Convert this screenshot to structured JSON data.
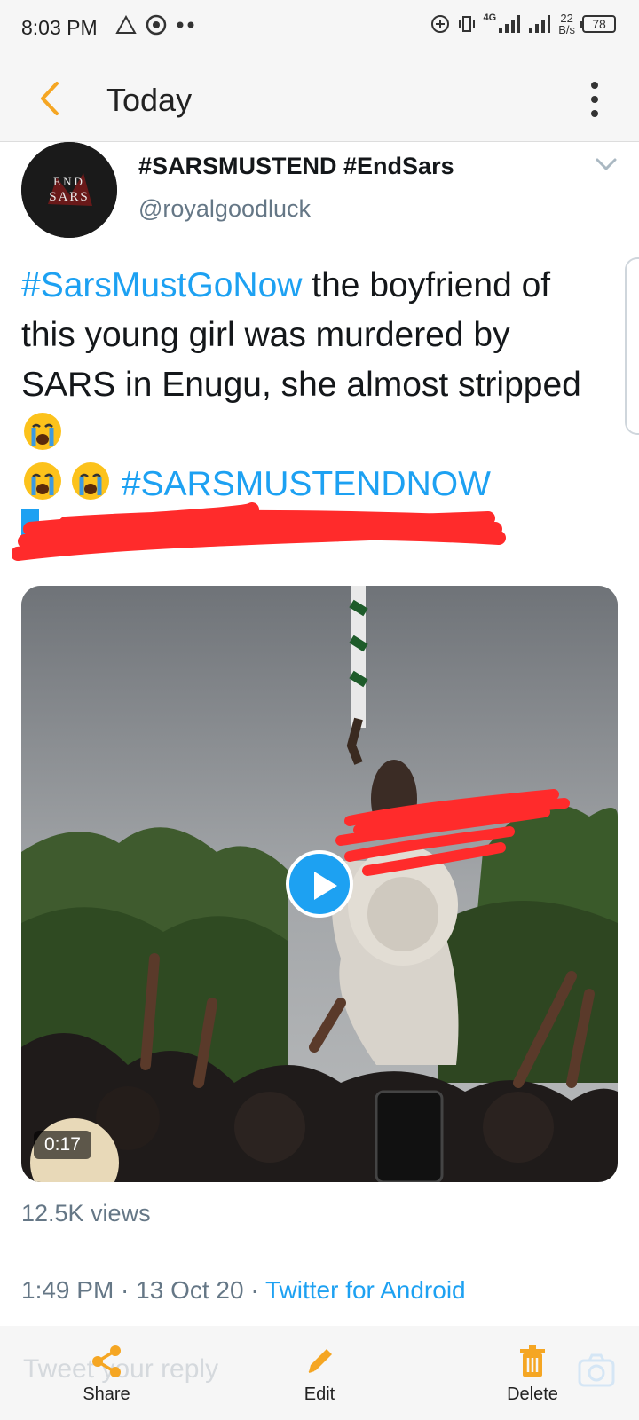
{
  "status_bar": {
    "time": "8:03 PM",
    "network_type": "4G",
    "net_speed_value": "22",
    "net_speed_unit": "B/s",
    "battery": "78"
  },
  "app_bar": {
    "title": "Today"
  },
  "tweet": {
    "display_name": "#SARSMUSTEND #EndSars",
    "handle": "@royalgoodluck",
    "avatar_text_line1": "END",
    "avatar_text_line2": "SARS",
    "text_hashtag_1": "#SarsMustGoNow",
    "text_body": " the boyfriend of this young girl was murdered by SARS in Enugu, she almost stripped ",
    "text_hashtag_2": "#SARSMUSTENDNOW",
    "media": {
      "duration": "0:17"
    },
    "views": "12.5K views",
    "time": "1:49 PM",
    "date": "13 Oct 20",
    "separator": " · ",
    "source": "Twitter for Android"
  },
  "bottom_bar": {
    "reply_placeholder": "Tweet your reply",
    "share_label": "Share",
    "edit_label": "Edit",
    "delete_label": "Delete"
  },
  "colors": {
    "accent": "#1da1f2",
    "icon_orange": "#f5a623",
    "redaction": "#ff2b2b"
  }
}
